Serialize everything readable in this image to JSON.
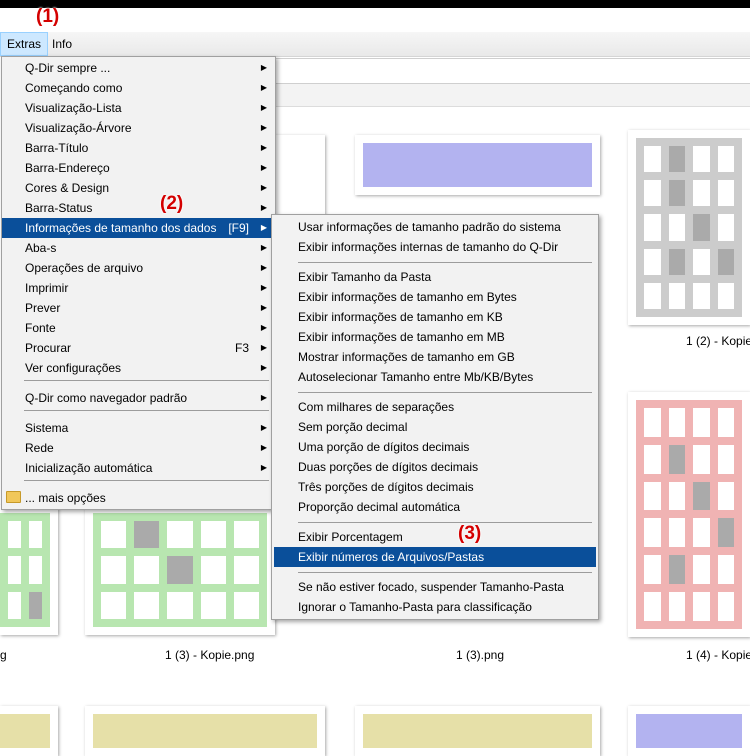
{
  "annotations": {
    "a1": "(1)",
    "a2": "(2)",
    "a3": "(3)"
  },
  "menubar": {
    "extras": "Extras",
    "info": "Info"
  },
  "extras_menu": [
    {
      "label": "Q-Dir sempre ...",
      "arrow": true
    },
    {
      "label": "Começando como",
      "arrow": true
    },
    {
      "label": "Visualização-Lista",
      "arrow": true
    },
    {
      "label": "Visualização-Árvore",
      "arrow": true
    },
    {
      "label": "Barra-Título",
      "arrow": true
    },
    {
      "label": "Barra-Endereço",
      "arrow": true
    },
    {
      "label": "Cores & Design",
      "arrow": true
    },
    {
      "label": "Barra-Status",
      "arrow": true
    },
    {
      "label": "Informações de tamanho dos dados",
      "shortcut": "[F9]",
      "arrow": true,
      "highlight": true
    },
    {
      "label": "Aba-s",
      "arrow": true
    },
    {
      "label": "Operações de arquivo",
      "arrow": true
    },
    {
      "label": "Imprimir",
      "arrow": true
    },
    {
      "label": "Prever",
      "arrow": true
    },
    {
      "label": "Fonte",
      "arrow": true
    },
    {
      "label": "Procurar",
      "shortcut": "F3",
      "arrow": true
    },
    {
      "label": "Ver configurações",
      "arrow": true
    },
    {
      "label": "Q-Dir como navegador padrão",
      "arrow": true
    },
    {
      "label": "Sistema",
      "arrow": true
    },
    {
      "label": "Rede",
      "arrow": true
    },
    {
      "label": "Inicialização automática",
      "arrow": true
    },
    {
      "label": "... mais opções"
    }
  ],
  "size_submenu": [
    {
      "label": "Usar informações de tamanho padrão do sistema"
    },
    {
      "label": "Exibir informações internas de tamanho do Q-Dir"
    },
    {
      "label": "Exibir Tamanho da Pasta"
    },
    {
      "label": "Exibir informações de tamanho em Bytes"
    },
    {
      "label": "Exibir informações de tamanho em KB"
    },
    {
      "label": "Exibir informações de tamanho em MB"
    },
    {
      "label": "Mostrar informações de tamanho em GB"
    },
    {
      "label": "Autoselecionar Tamanho entre Mb/KB/Bytes"
    },
    {
      "label": "Com milhares de separações"
    },
    {
      "label": "Sem porção decimal"
    },
    {
      "label": "Uma porção de dígitos decimais"
    },
    {
      "label": "Duas porções de dígitos decimais"
    },
    {
      "label": "Três porções de dígitos decimais"
    },
    {
      "label": "Proporção decimal automática"
    },
    {
      "label": "Exibir Porcentagem"
    },
    {
      "label": "Exibir números de Arquivos/Pastas",
      "highlight": true
    },
    {
      "label": "Se não estiver focado, suspender Tamanho-Pasta"
    },
    {
      "label": "Ignorar o Tamanho-Pasta para classificação"
    }
  ],
  "thumbnails": {
    "captions": [
      "1 (2) - Kopie",
      "1 (3) - Kopie.png",
      "1 (3).png",
      "1 (4) - Kopie"
    ]
  },
  "colors": {
    "blue": "#b3b3f0",
    "gray": "#cccccc",
    "red": "#f0b3b3",
    "green": "#b8e6b0",
    "yellow": "#e6e0a8",
    "highlight": "#0a4f9a"
  }
}
